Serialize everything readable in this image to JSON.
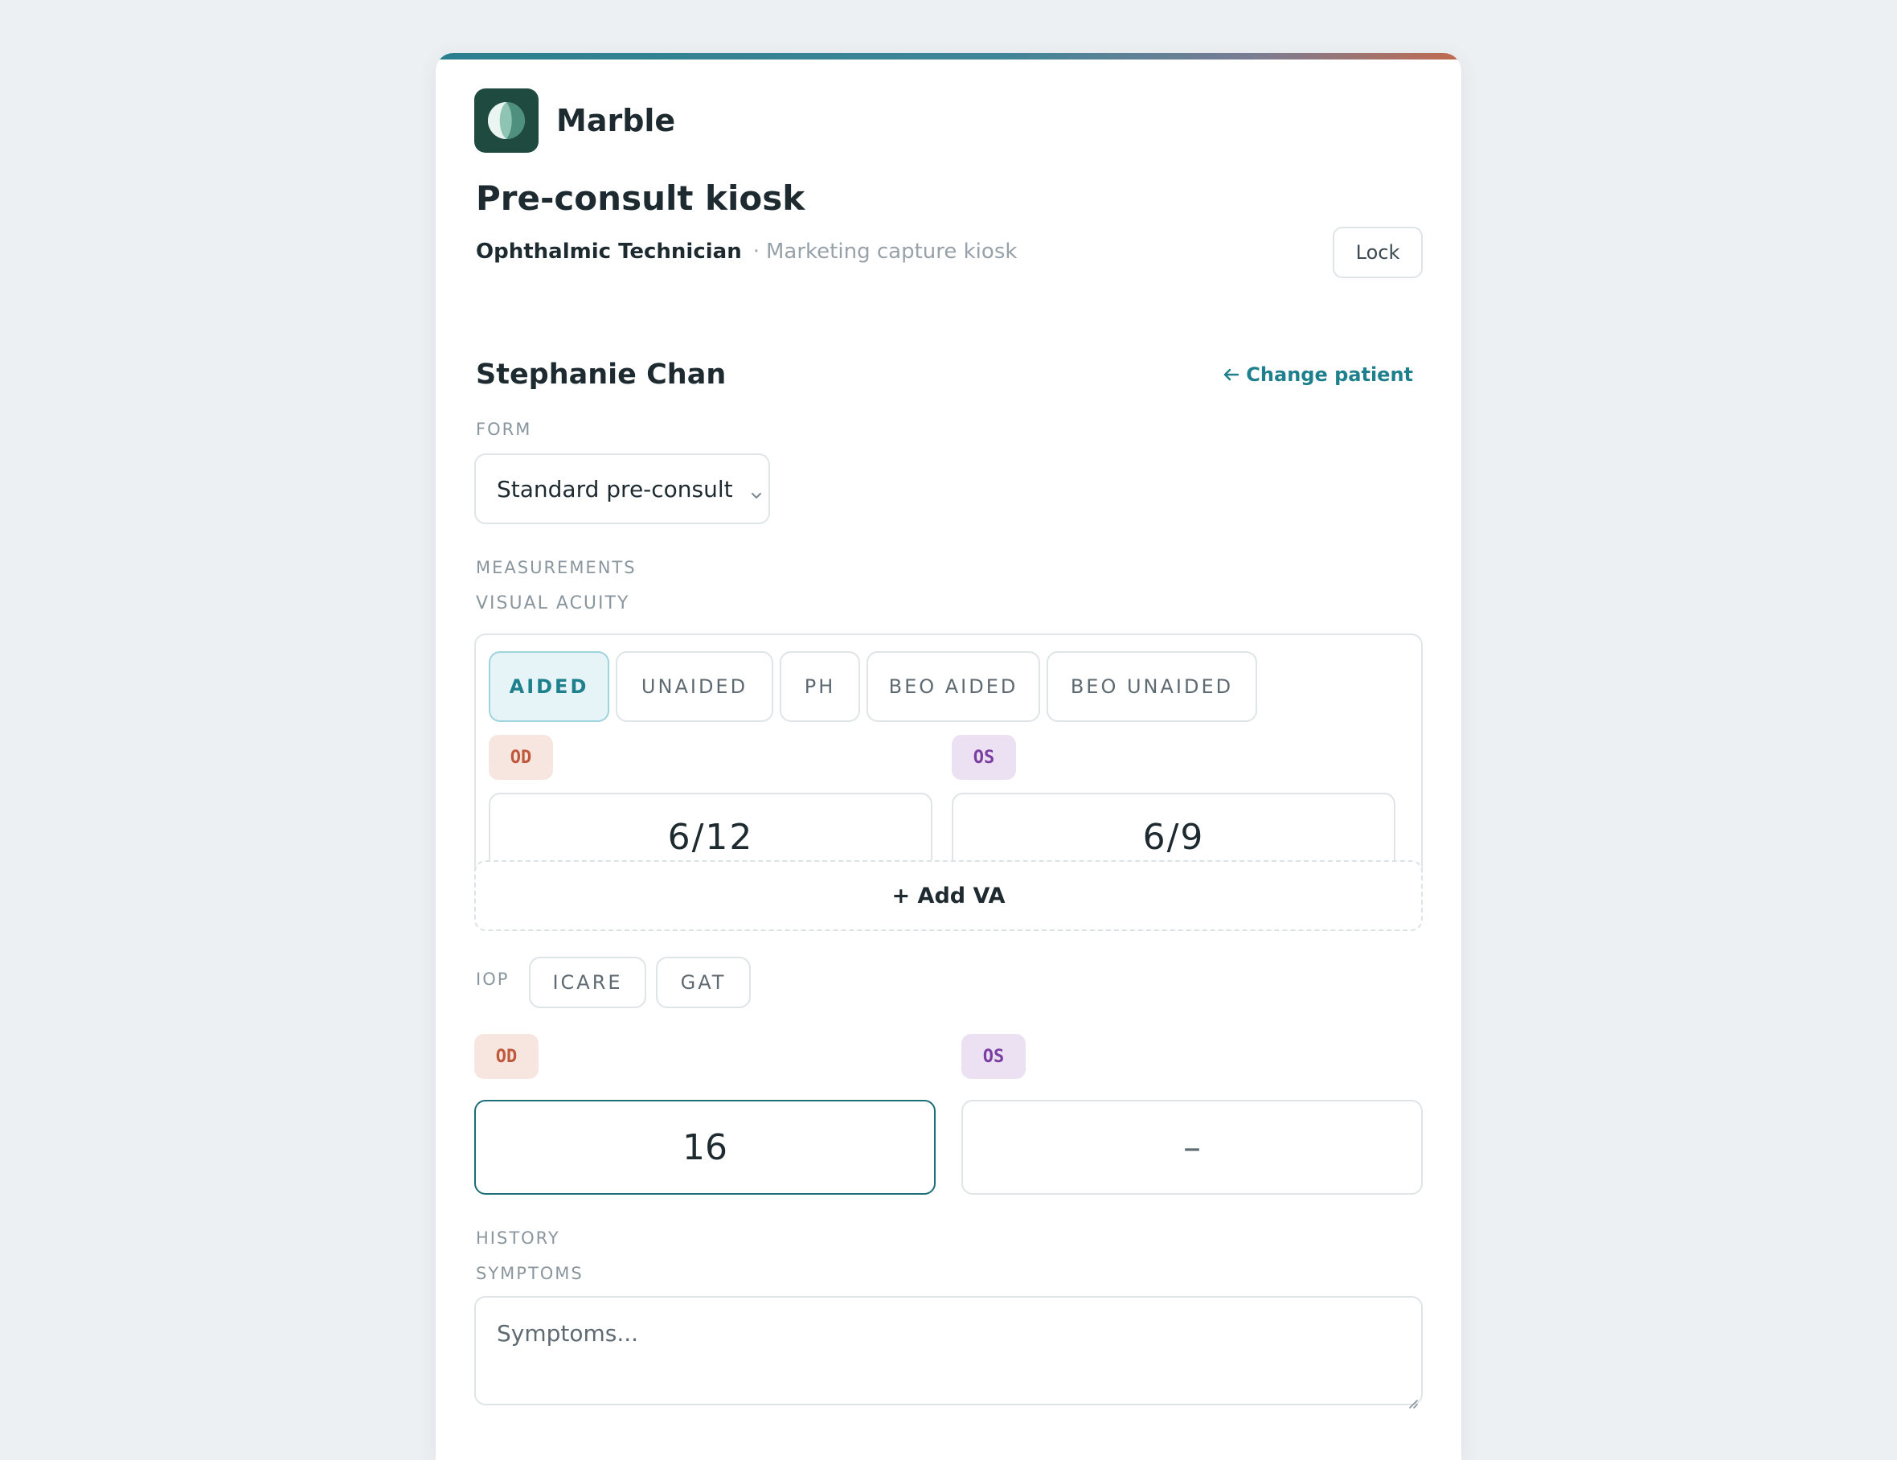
{
  "brand": {
    "name": "Marble",
    "icon": "marble-logo-icon"
  },
  "header": {
    "title": "Pre-consult kiosk",
    "role": "Ophthalmic Technician",
    "separator": "·",
    "subtitle": "Marketing capture kiosk",
    "lock_label": "Lock"
  },
  "patient": {
    "name": "Stephanie Chan",
    "change_label": "Change patient",
    "change_icon": "arrow-left-icon"
  },
  "form": {
    "section_label": "FORM",
    "selected": "Standard pre-consult",
    "icon": "chevron-down-icon"
  },
  "measurements": {
    "section_label": "MEASUREMENTS",
    "va": {
      "label": "VISUAL ACUITY",
      "tabs": [
        {
          "label": "AIDED",
          "active": true
        },
        {
          "label": "UNAIDED",
          "active": false
        },
        {
          "label": "PH",
          "active": false
        },
        {
          "label": "BEO AIDED",
          "active": false
        },
        {
          "label": "BEO UNAIDED",
          "active": false
        }
      ],
      "od_label": "OD",
      "os_label": "OS",
      "od_value": "6/12",
      "os_value": "6/9"
    },
    "add_va_label": "+ Add VA",
    "iop": {
      "label": "IOP",
      "methods": [
        "ICARE",
        "GAT"
      ],
      "od_label": "OD",
      "os_label": "OS",
      "od_value": "16",
      "os_value": "–"
    }
  },
  "history": {
    "section_label": "HISTORY",
    "symptoms_label": "SYMPTOMS",
    "symptoms_placeholder": "Symptoms..."
  },
  "colors": {
    "accent": "#1e7f8d",
    "od": "#c0583c",
    "os": "#7a3fa0",
    "logo_bg": "#1f4a40"
  }
}
